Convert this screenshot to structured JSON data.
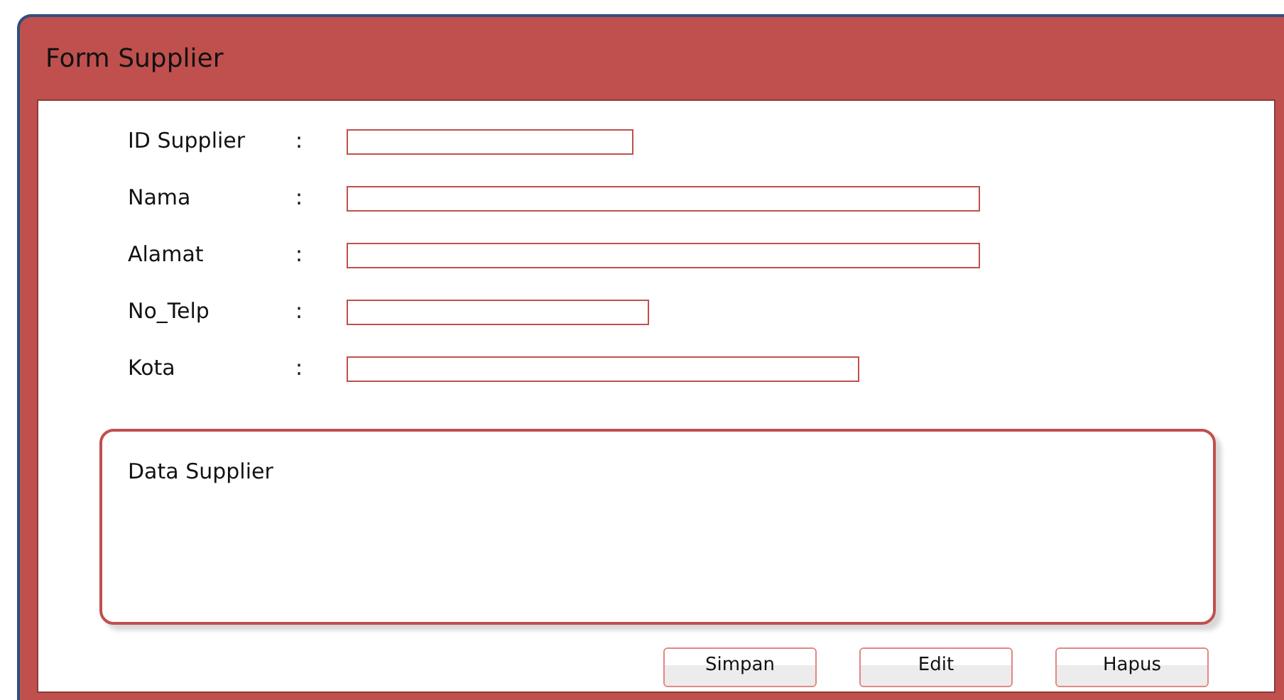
{
  "window": {
    "title": "Form Supplier"
  },
  "fields": [
    {
      "label": "ID Supplier",
      "separator": ":"
    },
    {
      "label": "Nama",
      "separator": ":"
    },
    {
      "label": "Alamat",
      "separator": ":"
    },
    {
      "label": "No_Telp",
      "separator": ":"
    },
    {
      "label": "Kota",
      "separator": ":"
    }
  ],
  "data_panel": {
    "title": "Data Supplier"
  },
  "buttons": [
    "Simpan",
    "Edit",
    "Hapus"
  ]
}
